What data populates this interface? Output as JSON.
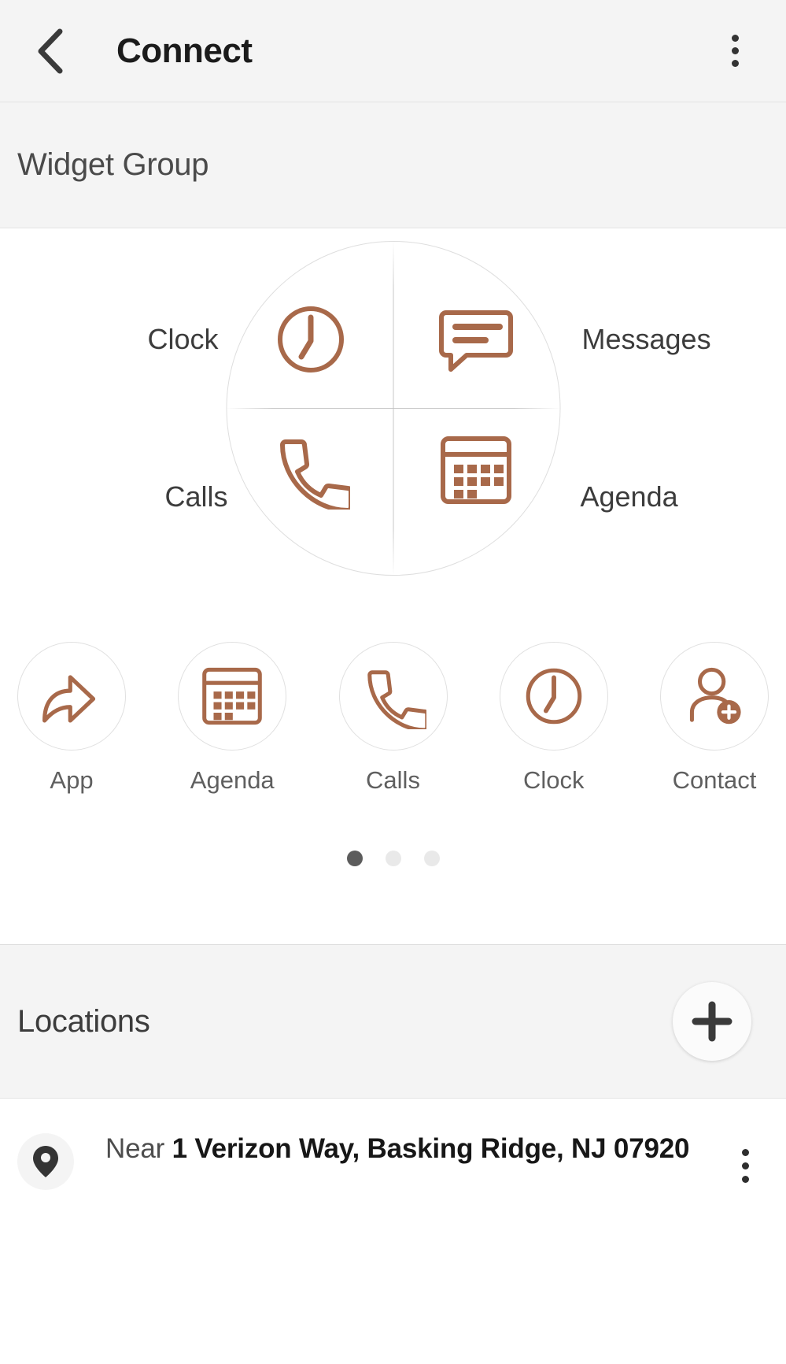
{
  "appbar": {
    "title": "Connect",
    "back_icon": "back-chevron-icon",
    "overflow_icon": "overflow-menu-icon"
  },
  "widget_group": {
    "section_title": "Widget Group",
    "wheel": {
      "quadrants": [
        {
          "label": "Clock",
          "icon": "clock-icon",
          "position": "top-left"
        },
        {
          "label": "Messages",
          "icon": "message-icon",
          "position": "top-right"
        },
        {
          "label": "Calls",
          "icon": "phone-icon",
          "position": "bottom-left"
        },
        {
          "label": "Agenda",
          "icon": "calendar-icon",
          "position": "bottom-right"
        }
      ]
    },
    "shortcuts": [
      {
        "label": "App",
        "icon": "share-arrow-icon"
      },
      {
        "label": "Agenda",
        "icon": "calendar-icon"
      },
      {
        "label": "Calls",
        "icon": "phone-icon"
      },
      {
        "label": "Clock",
        "icon": "clock-icon"
      },
      {
        "label": "Contact",
        "icon": "add-contact-icon"
      }
    ],
    "pager": {
      "count": 3,
      "active_index": 0
    }
  },
  "locations": {
    "section_title": "Locations",
    "add_button_icon": "plus-icon",
    "items": [
      {
        "pin_icon": "map-pin-icon",
        "prefix": "Near ",
        "address": "1 Verizon Way, Basking Ridge, NJ 07920",
        "overflow_icon": "overflow-menu-icon"
      }
    ]
  },
  "colors": {
    "accent": "#A8694A",
    "bar_background": "#f4f4f4",
    "text_primary": "#1b1b1b",
    "text_secondary": "#5f5f5f",
    "pager_active": "#5c5c5c",
    "pager_inactive": "#e9e9e9"
  }
}
